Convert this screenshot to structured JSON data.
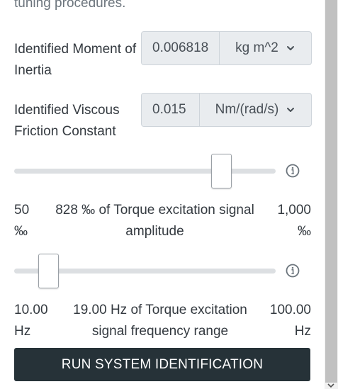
{
  "intro_text": "tuning procedures.",
  "inertia": {
    "label": "Identified Moment of Inertia",
    "value": "0.006818",
    "unit": "kg m^2"
  },
  "friction": {
    "label": "Identified Viscous Friction Constant",
    "value": "0.015",
    "unit": "Nm/(rad/s)"
  },
  "torque_amplitude": {
    "min_label": "50 ‰",
    "max_label": "1,000 ‰",
    "caption": "828 ‰ of Torque excitation signal amplitude",
    "value": 828,
    "min": 50,
    "max": 1000
  },
  "frequency_range": {
    "min_label": "10.00 Hz",
    "max_label": "100.00 Hz",
    "caption": "19.00 Hz of Torque excitation signal frequency range",
    "value": 19.0,
    "min": 10.0,
    "max": 100.0
  },
  "run_button": "RUN SYSTEM IDENTIFICATION",
  "icons": {
    "info": "info-icon",
    "select": "chevron-down-icon"
  },
  "colors": {
    "button_bg": "#263238",
    "track": "#dcdfe2",
    "input_bg": "#e9ecef"
  }
}
